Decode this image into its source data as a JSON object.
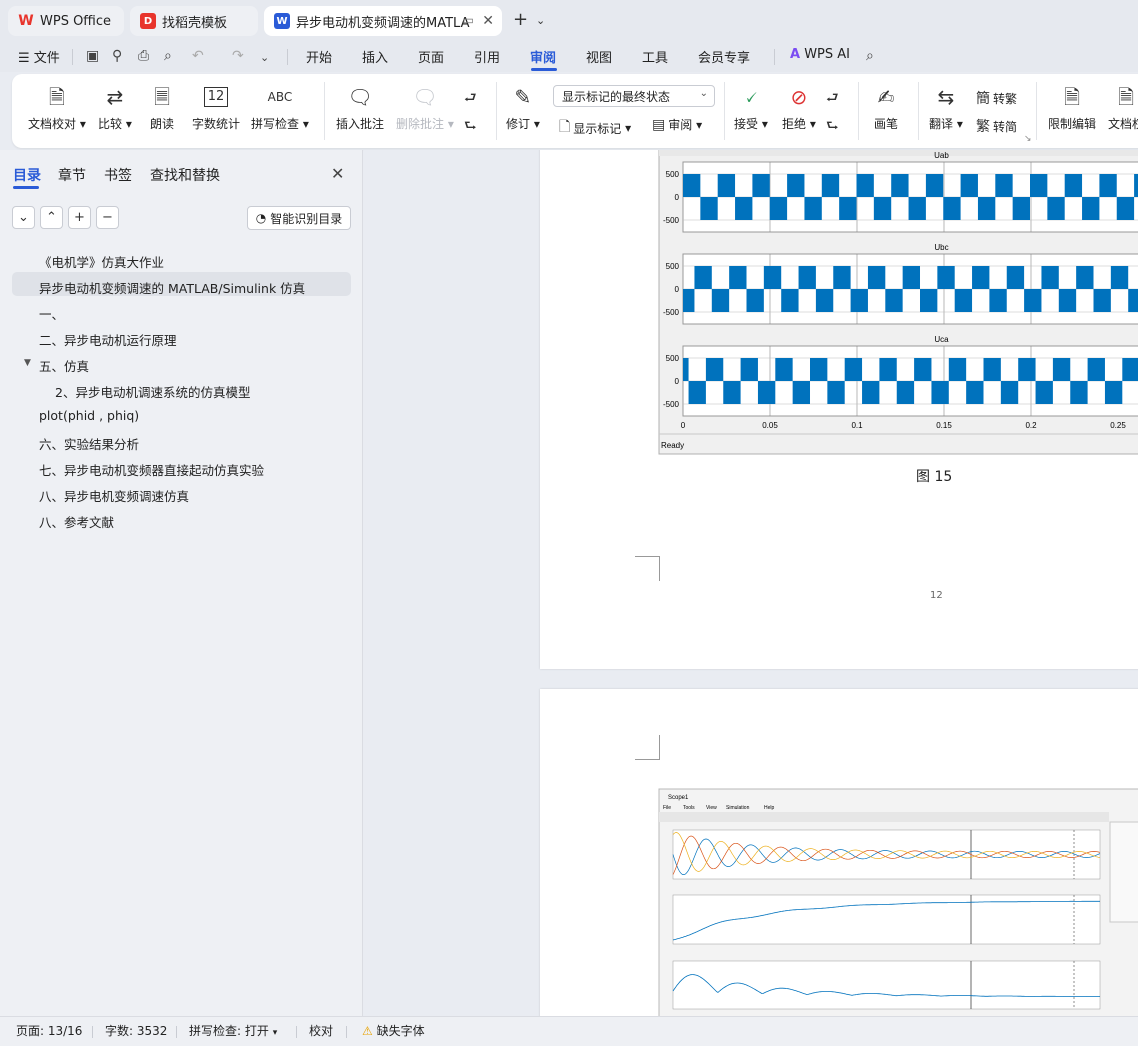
{
  "tabs": [
    {
      "label": "WPS Office",
      "icon": "wps-logo-icon",
      "color": "#e8342c"
    },
    {
      "label": "找稻壳模板",
      "icon": "docer-icon",
      "color": "#e8342c"
    },
    {
      "label": "异步电动机变频调速的MATLA",
      "icon": "word-doc-icon",
      "color": "#2a5bd7"
    }
  ],
  "new_tab": "+",
  "menu": {
    "file": "文件",
    "items": [
      "开始",
      "插入",
      "页面",
      "引用",
      "审阅",
      "视图",
      "工具",
      "会员专享"
    ],
    "active": "审阅",
    "ai": "WPS AI"
  },
  "ribbon": {
    "doc_check": "文档校对",
    "compare": "比较",
    "read_aloud": "朗读",
    "word_count": "字数统计",
    "spell_check": "拼写检查",
    "insert_comment": "插入批注",
    "delete_comment": "删除批注",
    "revise": "修订",
    "display_mode": "显示标记的最终状态",
    "show_markup": "显示标记",
    "review": "审阅",
    "accept": "接受",
    "reject": "拒绝",
    "pen": "画笔",
    "translate": "翻译",
    "to_traditional": "转繁",
    "to_simplified": "转简",
    "restrict_edit": "限制编辑",
    "doc_permission": "文档权"
  },
  "nav": {
    "tabs": [
      "目录",
      "章节",
      "书签",
      "查找和替换"
    ],
    "active_tab": "目录",
    "smart_toc": "智能识别目录",
    "toc": [
      "《电机学》仿真大作业",
      "异步电动机变频调速的 MATLAB/Simulink 仿真",
      "一、",
      "二、异步电动机运行原理",
      "五、仿真",
      "2、异步电动机调速系统的仿真模型",
      "plot(phid , phiq)",
      "六、实验结果分析",
      "七、异步电动机变频器直接起动仿真实验",
      "八、异步电机变频调速仿真",
      "八、参考文献"
    ]
  },
  "page1": {
    "scope_titles": [
      "Uab",
      "Ubc",
      "Uca"
    ],
    "y_ticks": [
      "500",
      "0",
      "-500"
    ],
    "x_ticks": [
      "0",
      "0.05",
      "0.1",
      "0.15",
      "0.2",
      "0.25"
    ],
    "status": "Ready",
    "caption": "图  15",
    "page_number": "12",
    "wave_color": "#0072bd"
  },
  "page2": {
    "window_title": "Scope1",
    "menu": [
      "File",
      "Tools",
      "View",
      "Simulation",
      "Help"
    ],
    "series_colors": [
      "#0072bd",
      "#d95319",
      "#edb120"
    ]
  },
  "status": {
    "page": "页面: 13/16",
    "words": "字数: 3532",
    "spell": "拼写检查: 打开",
    "proof": "校对",
    "missing_font": "缺失字体"
  }
}
